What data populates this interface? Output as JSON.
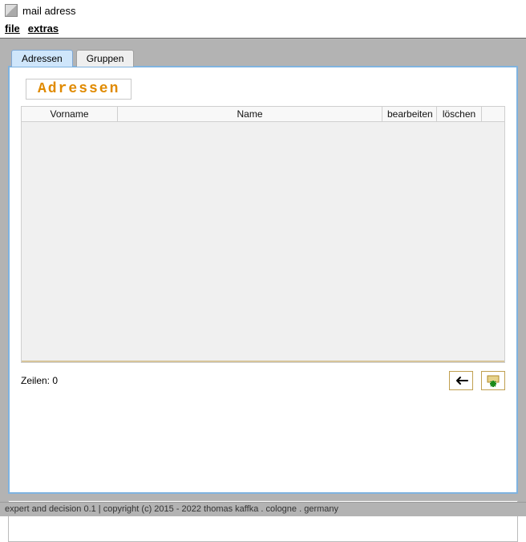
{
  "titlebar": {
    "title": "mail adress"
  },
  "menu": {
    "file": "file",
    "extras": "extras"
  },
  "tabs": {
    "adressen": "Adressen",
    "gruppen": "Gruppen"
  },
  "panel": {
    "heading": "Adressen",
    "columns": {
      "vorname": "Vorname",
      "name": "Name",
      "bearbeiten": "bearbeiten",
      "loeschen": "löschen"
    },
    "row_count_label": "Zeilen: 0"
  },
  "status": "expert and decision 0.1 | copyright (c) 2015 - 2022 thomas kaffka . cologne . germany"
}
